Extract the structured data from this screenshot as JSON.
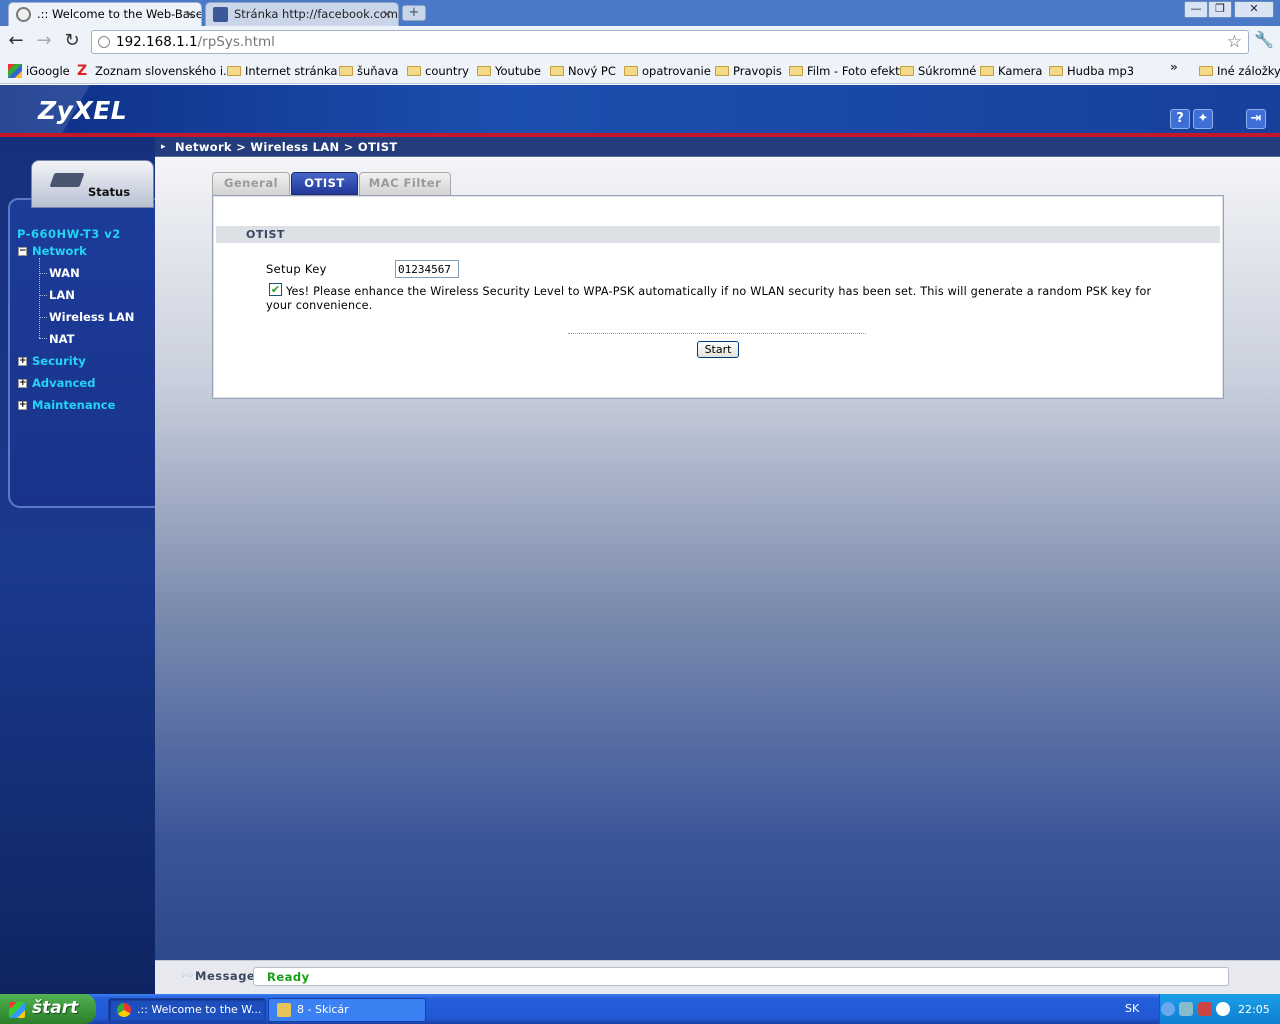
{
  "browser": {
    "tabs": [
      {
        "title": ".:: Welcome to the Web-Based",
        "active": true
      },
      {
        "title": "Stránka http://facebook.com/",
        "active": false
      }
    ],
    "new_tab": "+",
    "url_host": "192.168.1.1",
    "url_path": "/rpSys.html",
    "bookmarks": [
      "iGoogle",
      "Zoznam slovenského i...",
      "Internet stránka",
      "šuňava",
      "country",
      "Youtube",
      "Nový PC",
      "opatrovanie",
      "Pravopis",
      "Film - Foto efekt",
      "Súkromné",
      "Kamera",
      "Hudba mp3"
    ],
    "bookmarks_more": "»",
    "other_bookmarks": "Iné záložky"
  },
  "router": {
    "brand": "ZyXEL",
    "breadcrumb": "Network > Wireless LAN > OTIST",
    "status_tab": "Status",
    "model": "P-660HW-T3 v2",
    "menu": {
      "network": "Network",
      "network_items": [
        "WAN",
        "LAN",
        "Wireless LAN",
        "NAT"
      ],
      "security": "Security",
      "advanced": "Advanced",
      "maintenance": "Maintenance"
    },
    "tabs": [
      "General",
      "OTIST",
      "MAC Filter"
    ],
    "active_tab": "OTIST",
    "section_title": "OTIST",
    "setup_key_label": "Setup Key",
    "setup_key_value": "01234567",
    "checkbox_checked": true,
    "checkbox_text": "Yes! Please enhance the Wireless Security Level to WPA-PSK automatically if no WLAN security has been set. This will generate a random PSK key for your convenience.",
    "start_button": "Start",
    "message_label": "Message",
    "message_text": "Ready"
  },
  "taskbar": {
    "start": "štart",
    "tasks": [
      ".:: Welcome to the W...",
      "8 - Skicár"
    ],
    "language": "SK",
    "clock": "22:05"
  }
}
